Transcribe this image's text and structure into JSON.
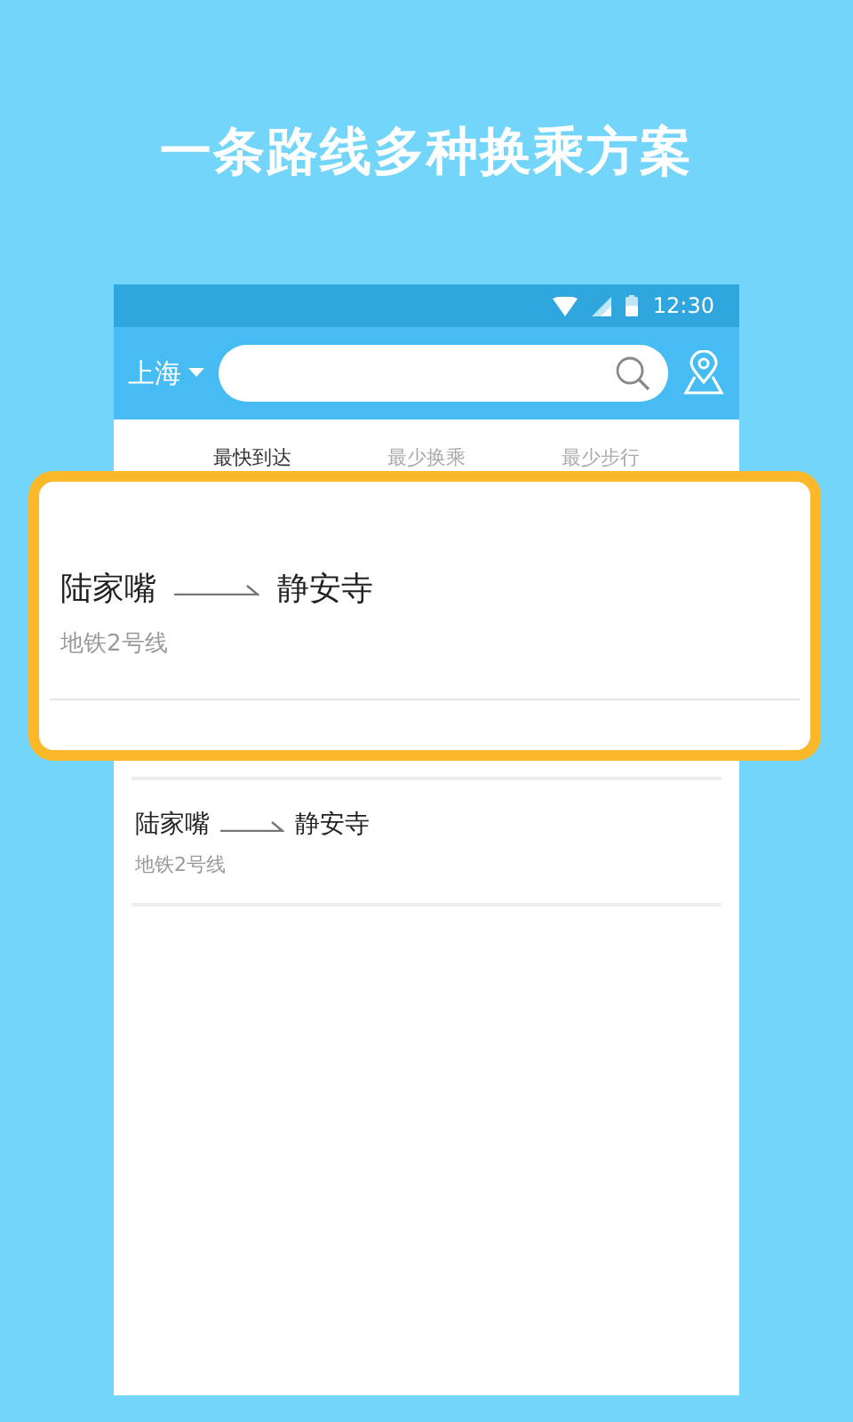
{
  "headline": "一条路线多种换乘方案",
  "status_bar": {
    "time": "12:30"
  },
  "toolbar": {
    "city": "上海"
  },
  "tabs": [
    {
      "label": "最快到达",
      "selected": true
    },
    {
      "label": "最少换乘",
      "selected": false
    },
    {
      "label": "最少步行",
      "selected": false
    }
  ],
  "highlighted_route": {
    "from": "陆家嘴",
    "to": "静安寺",
    "line": "地铁2号线"
  },
  "routes": [
    {
      "from": "陆家嘴",
      "to": "静安寺",
      "line": "地铁2号线"
    }
  ]
}
